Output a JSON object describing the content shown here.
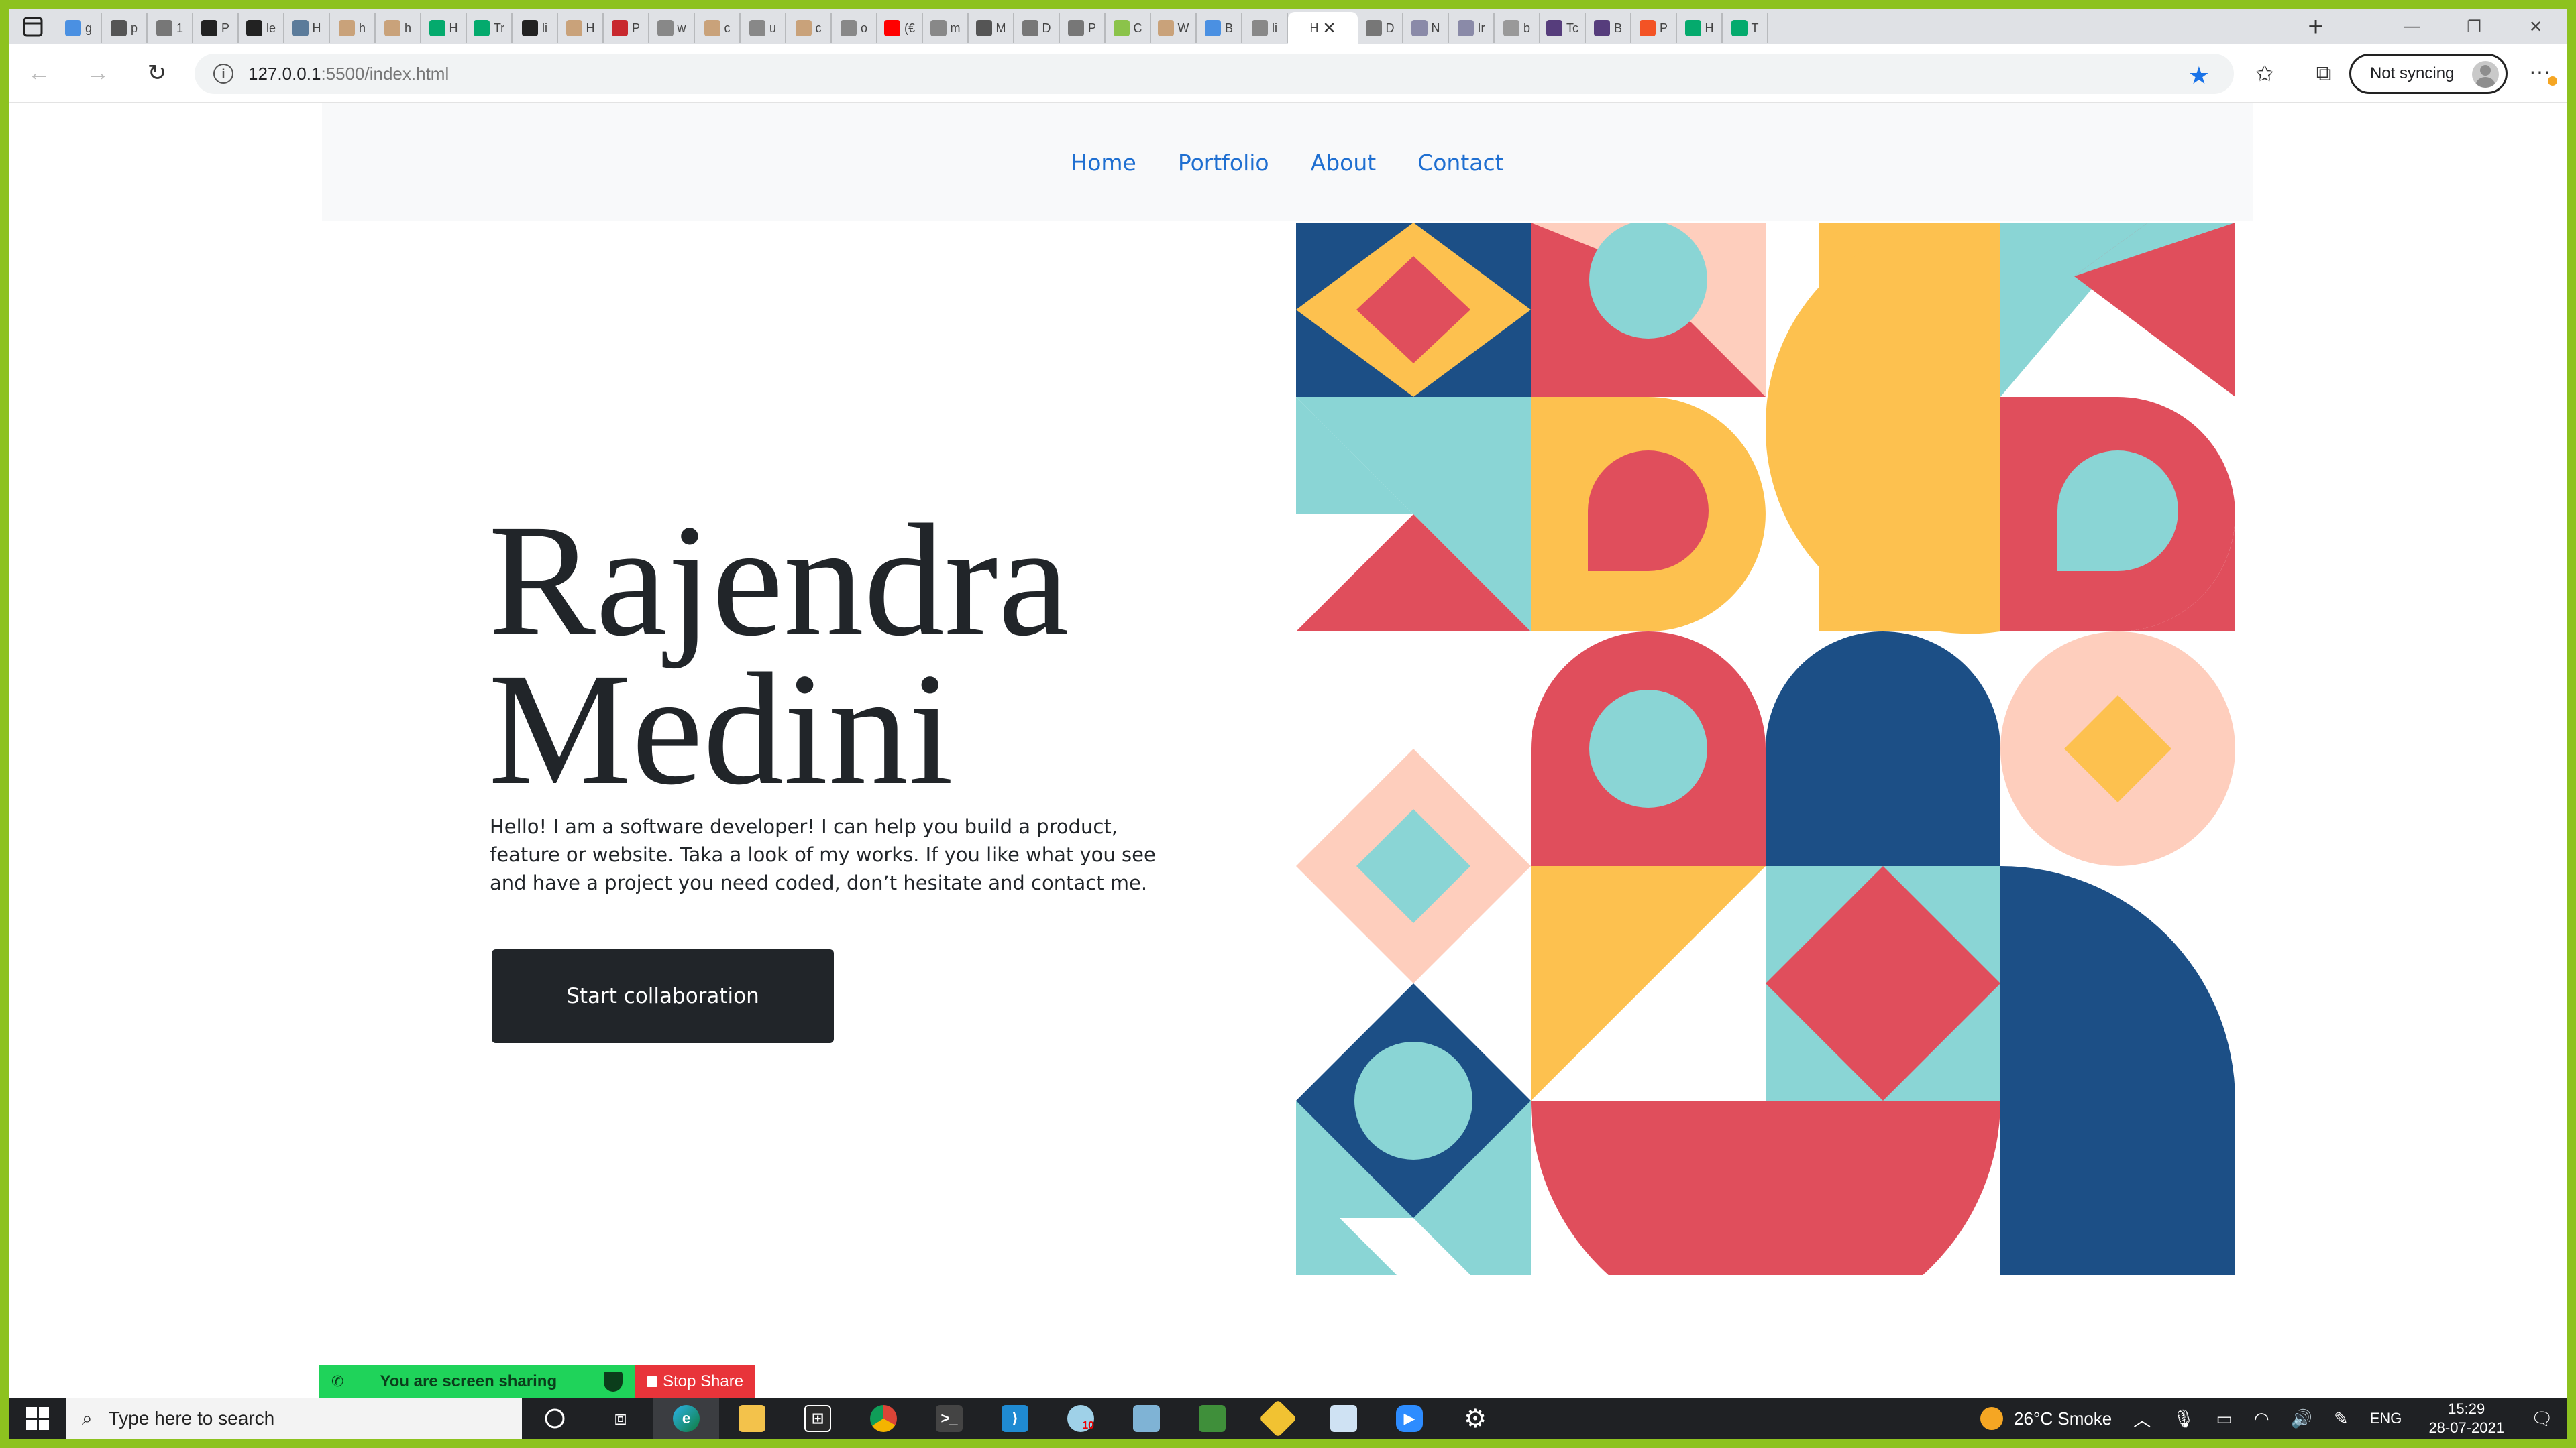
{
  "browser": {
    "tabs": [
      {
        "icon": "bing",
        "letter": "g",
        "color": "#4a90e2"
      },
      {
        "icon": "bookmark",
        "letter": "p",
        "color": "#555555"
      },
      {
        "icon": "gear",
        "letter": "1",
        "color": "#777777"
      },
      {
        "icon": "github",
        "letter": "P",
        "color": "#222222"
      },
      {
        "icon": "github",
        "letter": "le",
        "color": "#222222"
      },
      {
        "icon": "image",
        "letter": "H",
        "color": "#5b7b9a"
      },
      {
        "icon": "paper",
        "letter": "h",
        "color": "#c9a27a"
      },
      {
        "icon": "paper",
        "letter": "h",
        "color": "#c9a27a"
      },
      {
        "icon": "w3",
        "letter": "H",
        "color": "#04aa6d"
      },
      {
        "icon": "w3",
        "letter": "Tr",
        "color": "#04aa6d"
      },
      {
        "icon": "github",
        "letter": "li",
        "color": "#222222"
      },
      {
        "icon": "paper",
        "letter": "H",
        "color": "#c9a27a"
      },
      {
        "icon": "sfu",
        "letter": "P",
        "color": "#c8282e"
      },
      {
        "icon": "google",
        "letter": "w",
        "color": "#888888"
      },
      {
        "icon": "paper",
        "letter": "c",
        "color": "#c9a27a"
      },
      {
        "icon": "google",
        "letter": "u",
        "color": "#888888"
      },
      {
        "icon": "paper",
        "letter": "c",
        "color": "#c9a27a"
      },
      {
        "icon": "google",
        "letter": "o",
        "color": "#888888"
      },
      {
        "icon": "youtube",
        "letter": "(€",
        "color": "#ff0000"
      },
      {
        "icon": "google",
        "letter": "m",
        "color": "#888888"
      },
      {
        "icon": "bing",
        "letter": "M",
        "color": "#555555"
      },
      {
        "icon": "page",
        "letter": "D",
        "color": "#777777"
      },
      {
        "icon": "page",
        "letter": "P",
        "color": "#777777"
      },
      {
        "icon": "leaf",
        "letter": "C",
        "color": "#8bc34a"
      },
      {
        "icon": "paper",
        "letter": "W",
        "color": "#c9a27a"
      },
      {
        "icon": "ruler",
        "letter": "B",
        "color": "#4a90e2"
      },
      {
        "icon": "google",
        "letter": "li",
        "color": "#888888"
      }
    ],
    "active_tab": {
      "letter": "H",
      "close": "✕"
    },
    "tabs_after": [
      {
        "icon": "page",
        "letter": "D",
        "color": "#777777"
      },
      {
        "icon": "bootstrap",
        "letter": "N",
        "color": "#8a8aa8"
      },
      {
        "icon": "bootstrap",
        "letter": "Ir",
        "color": "#8a8aa8"
      },
      {
        "icon": "tools",
        "letter": "b",
        "color": "#999999"
      },
      {
        "icon": "bootstrap",
        "letter": "Tc",
        "color": "#563d7c"
      },
      {
        "icon": "bootstrap",
        "letter": "B",
        "color": "#563d7c"
      },
      {
        "icon": "ms",
        "letter": "P",
        "color": "#f35325"
      },
      {
        "icon": "w3",
        "letter": "H",
        "color": "#04aa6d"
      },
      {
        "icon": "w3",
        "letter": "T",
        "color": "#04aa6d"
      }
    ],
    "new_tab": "+",
    "window": {
      "minimize": "—",
      "restore": "❐",
      "close": "✕"
    },
    "url_host": "127.0.0.1",
    "url_path": ":5500/index.html",
    "sync_label": "Not syncing",
    "menu": "···"
  },
  "site": {
    "nav": [
      "Home",
      "Portfolio",
      "About",
      "Contact"
    ],
    "name_line1": "Rajendra",
    "name_line2": "Medini",
    "intro": "Hello! I am a software developer! I can help you build a product, feature or website. Taka a look of my works. If you like what you see and have a project you need coded, don’t hesitate and contact me.",
    "cta": "Start collaboration"
  },
  "palette": {
    "red": "#e04e5c",
    "yellow": "#fdc14f",
    "teal": "#8ad5d5",
    "navy": "#1c4f86",
    "peach": "#fecebd"
  },
  "zoom": {
    "sharing": "You are screen sharing",
    "stop": "Stop Share"
  },
  "taskbar": {
    "search_placeholder": "Type here to search",
    "weather": "26°C  Smoke",
    "lang": "ENG",
    "time": "15:29",
    "date": "28-07-2021",
    "badge": "10"
  }
}
